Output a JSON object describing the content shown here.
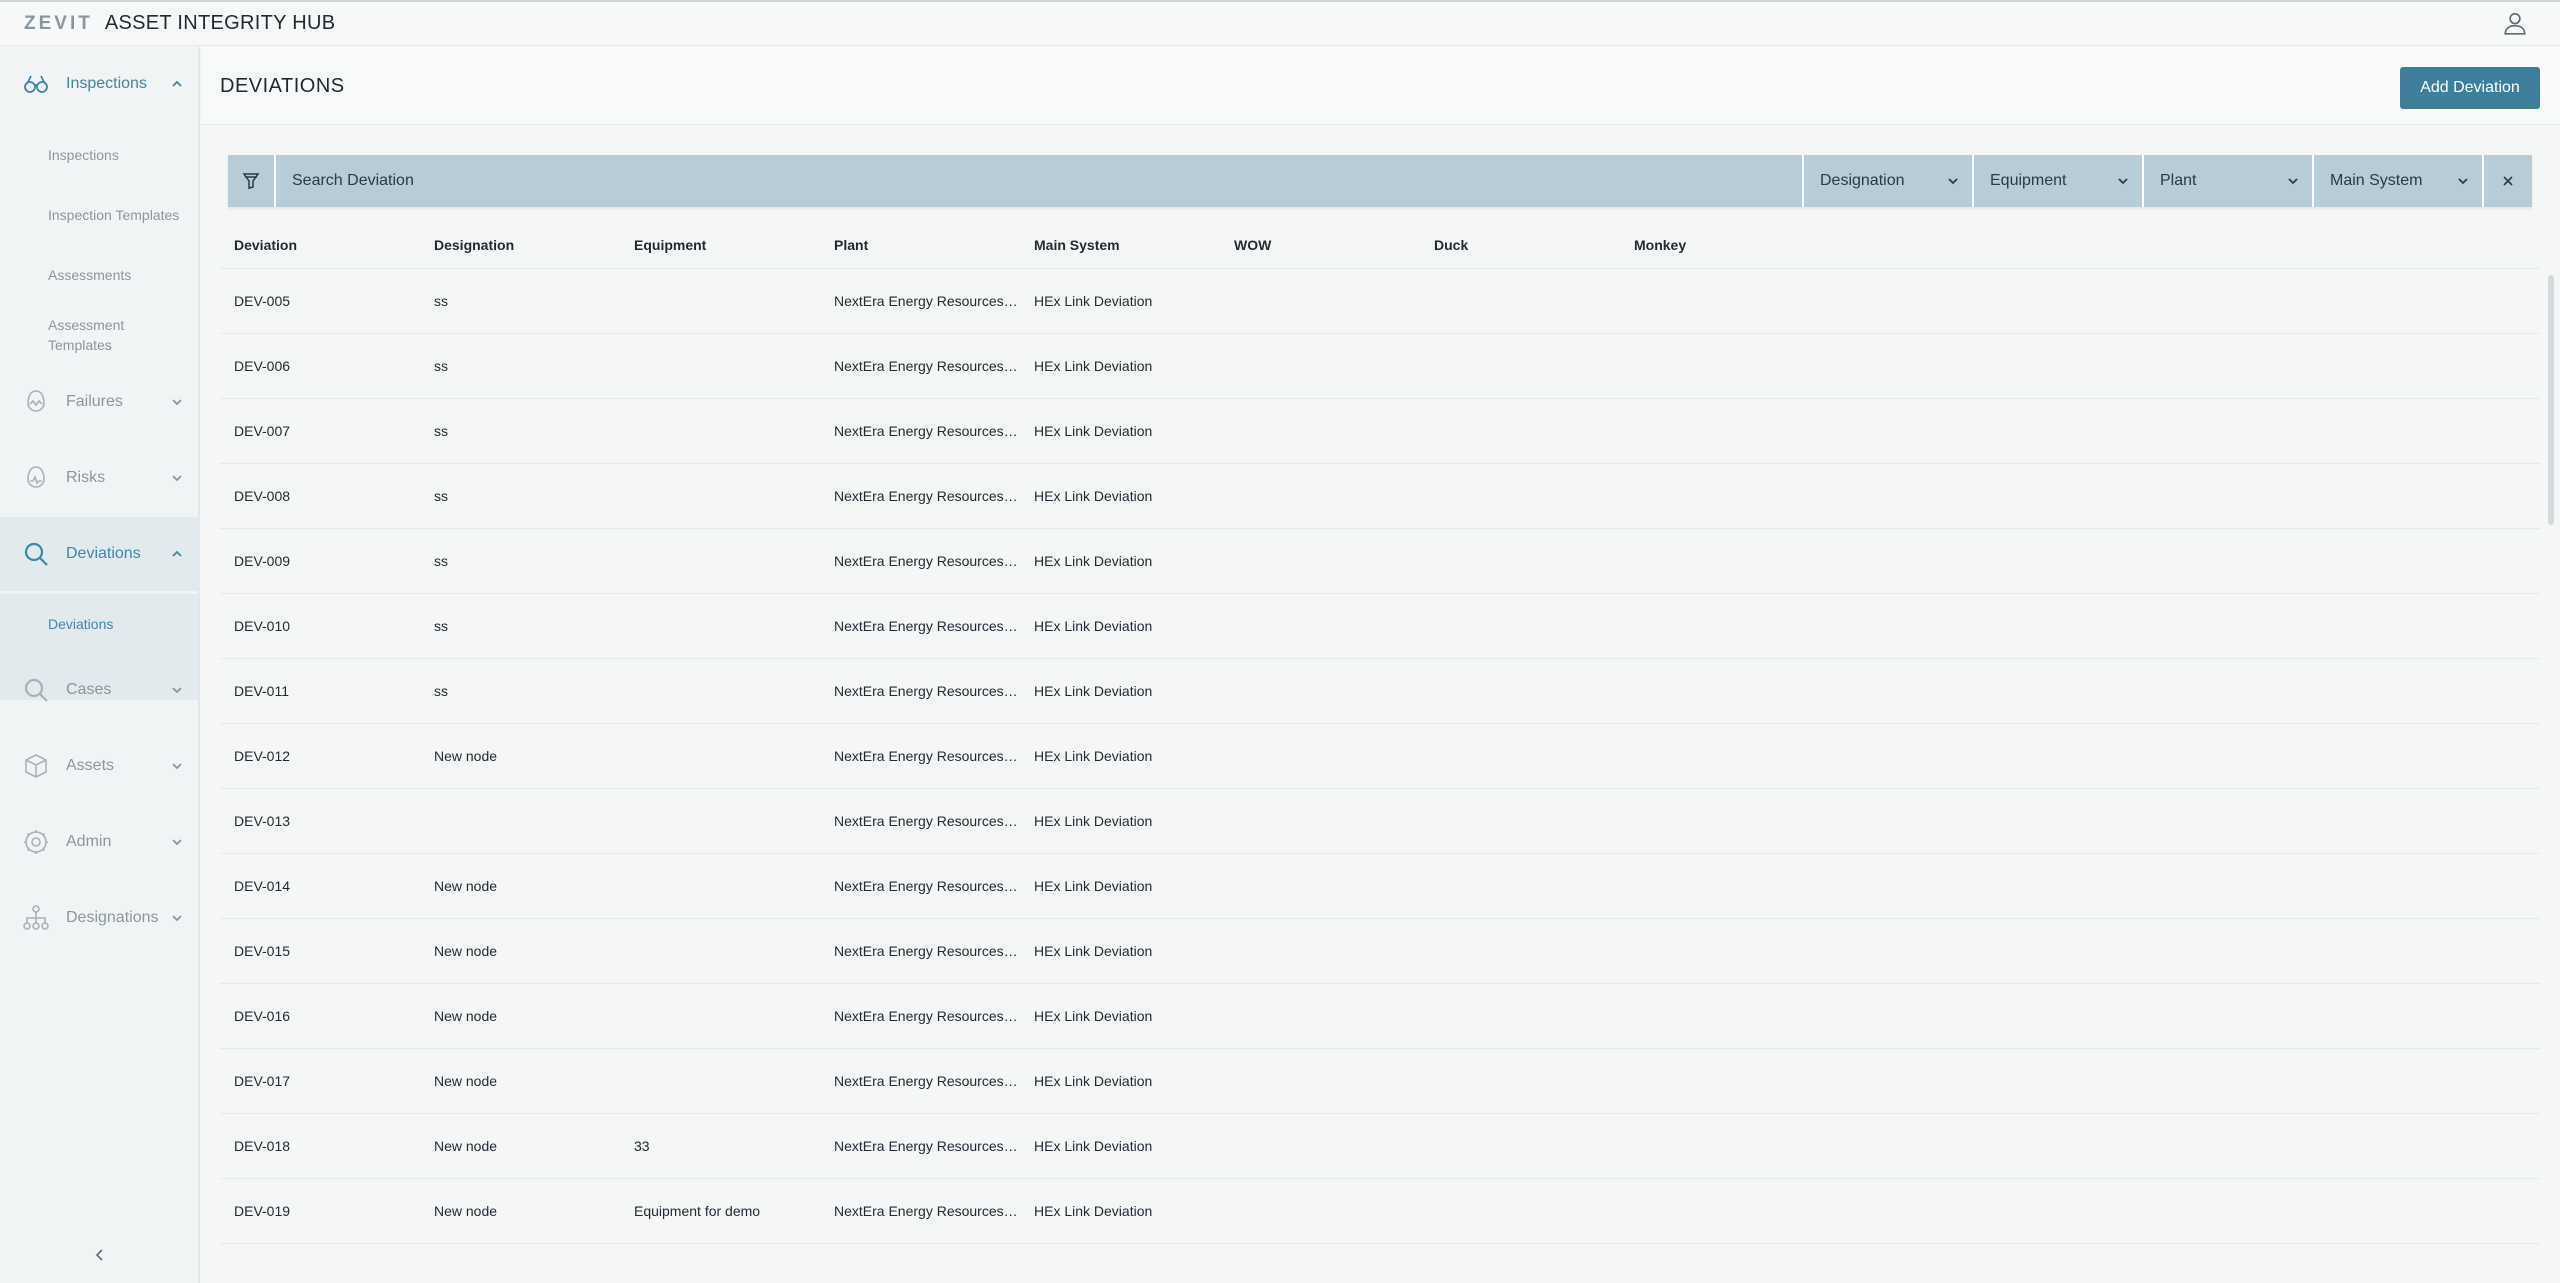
{
  "header": {
    "brand": "ZEVIT",
    "app_title": "ASSET INTEGRITY HUB",
    "user_icon": "user-icon"
  },
  "sidebar": {
    "groups": [
      {
        "label": "Inspections",
        "icon": "binoculars-icon",
        "expanded": true
      },
      {
        "label": "Failures",
        "icon": "failures-icon",
        "expanded": false
      },
      {
        "label": "Risks",
        "icon": "risks-icon",
        "expanded": false
      },
      {
        "label": "Deviations",
        "icon": "search-icon",
        "expanded": true
      },
      {
        "label": "Cases",
        "icon": "search-icon",
        "expanded": false
      },
      {
        "label": "Assets",
        "icon": "cube-icon",
        "expanded": false
      },
      {
        "label": "Admin",
        "icon": "gear-icon",
        "expanded": false
      },
      {
        "label": "Designations",
        "icon": "hierarchy-icon",
        "expanded": false
      }
    ],
    "inspections_sub": [
      "Inspections",
      "Inspection Templates",
      "Assessments",
      "Assessment",
      "Templates"
    ],
    "deviations_sub": [
      "Deviations"
    ]
  },
  "page": {
    "title": "DEVIATIONS",
    "add_button": "Add Deviation"
  },
  "filters": {
    "search_placeholder": "Search Deviation",
    "dropdowns": [
      "Designation",
      "Equipment",
      "Plant",
      "Main System"
    ]
  },
  "table": {
    "columns": [
      "Deviation",
      "Designation",
      "Equipment",
      "Plant",
      "Main System",
      "WOW",
      "Duck",
      "Monkey"
    ],
    "rows": [
      [
        "DEV-005",
        "ss",
        "",
        "NextEra Energy Resources' ...",
        "HEx Link Deviation",
        "",
        "",
        ""
      ],
      [
        "DEV-006",
        "ss",
        "",
        "NextEra Energy Resources' ...",
        "HEx Link Deviation",
        "",
        "",
        ""
      ],
      [
        "DEV-007",
        "ss",
        "",
        "NextEra Energy Resources' ...",
        "HEx Link Deviation",
        "",
        "",
        ""
      ],
      [
        "DEV-008",
        "ss",
        "",
        "NextEra Energy Resources' ...",
        "HEx Link Deviation",
        "",
        "",
        ""
      ],
      [
        "DEV-009",
        "ss",
        "",
        "NextEra Energy Resources' ...",
        "HEx Link Deviation",
        "",
        "",
        ""
      ],
      [
        "DEV-010",
        "ss",
        "",
        "NextEra Energy Resources' ...",
        "HEx Link Deviation",
        "",
        "",
        ""
      ],
      [
        "DEV-011",
        "ss",
        "",
        "NextEra Energy Resources' ...",
        "HEx Link Deviation",
        "",
        "",
        ""
      ],
      [
        "DEV-012",
        "New node",
        "",
        "NextEra Energy Resources' ...",
        "HEx Link Deviation",
        "",
        "",
        ""
      ],
      [
        "DEV-013",
        "",
        "",
        "NextEra Energy Resources' ...",
        "HEx Link Deviation",
        "",
        "",
        ""
      ],
      [
        "DEV-014",
        "New node",
        "",
        "NextEra Energy Resources' ...",
        "HEx Link Deviation",
        "",
        "",
        ""
      ],
      [
        "DEV-015",
        "New node",
        "",
        "NextEra Energy Resources' ...",
        "HEx Link Deviation",
        "",
        "",
        ""
      ],
      [
        "DEV-016",
        "New node",
        "",
        "NextEra Energy Resources' ...",
        "HEx Link Deviation",
        "",
        "",
        ""
      ],
      [
        "DEV-017",
        "New node",
        "",
        "NextEra Energy Resources' ...",
        "HEx Link Deviation",
        "",
        "",
        ""
      ],
      [
        "DEV-018",
        "New node",
        "33",
        "NextEra Energy Resources' ...",
        "HEx Link Deviation",
        "",
        "",
        ""
      ],
      [
        "DEV-019",
        "New node",
        "Equipment for demo",
        "NextEra Energy Resources' ...",
        "HEx Link Deviation",
        "",
        "",
        ""
      ]
    ]
  },
  "colors": {
    "accent": "#3d86a8",
    "button": "#3d7f9a",
    "filter_bar": "#b7ccd6",
    "muted": "#8a969e"
  }
}
